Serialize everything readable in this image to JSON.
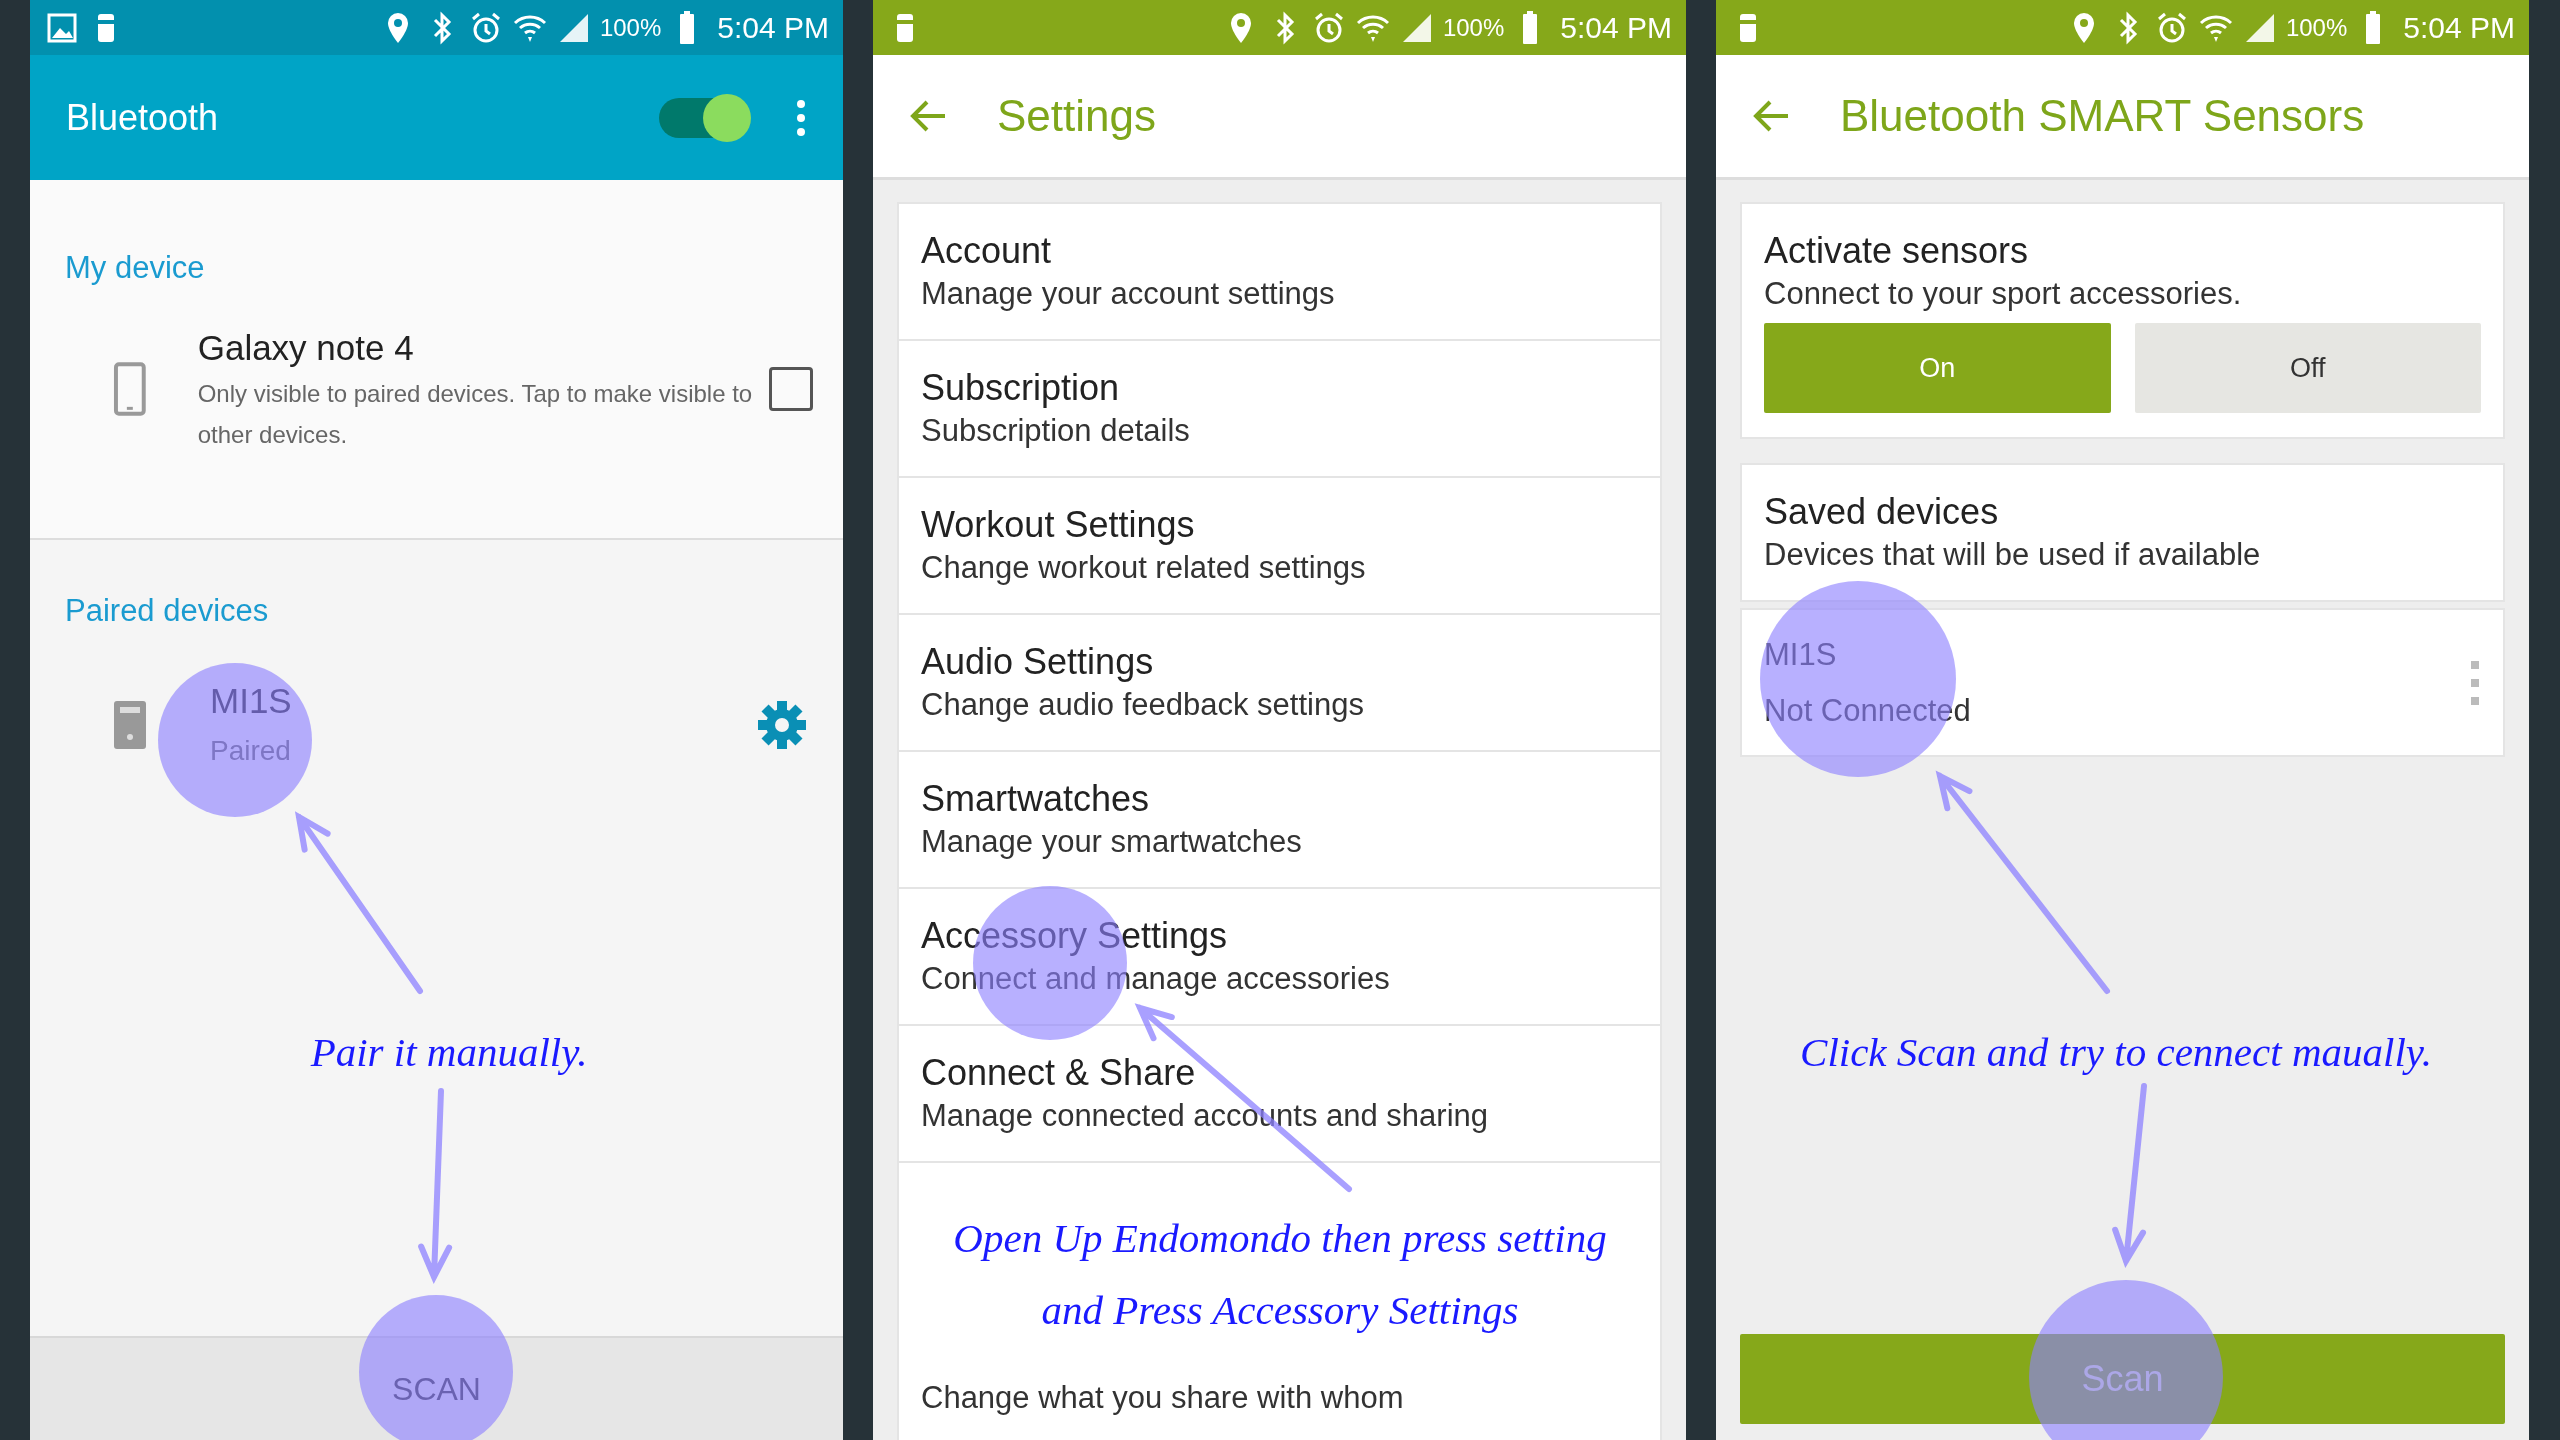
{
  "bluetooth_screen": {
    "status_bar": {
      "battery": "100%",
      "time": "5:04 PM"
    },
    "title": "Bluetooth",
    "toggle_on": true,
    "my_device": {
      "header": "My device",
      "name": "Galaxy note 4",
      "description": "Only visible to paired devices. Tap to make visible to other devices.",
      "checked": false
    },
    "paired_devices": {
      "header": "Paired devices",
      "items": [
        {
          "name": "MI1S",
          "status": "Paired"
        }
      ]
    },
    "scan_button": "SCAN"
  },
  "settings_screen": {
    "status_bar": {
      "battery": "100%",
      "time": "5:04 PM"
    },
    "title": "Settings",
    "items": [
      {
        "title": "Account",
        "subtitle": "Manage your account settings"
      },
      {
        "title": "Subscription",
        "subtitle": "Subscription details"
      },
      {
        "title": "Workout Settings",
        "subtitle": "Change workout related settings"
      },
      {
        "title": "Audio Settings",
        "subtitle": "Change audio feedback settings"
      },
      {
        "title": "Smartwatches",
        "subtitle": "Manage your smartwatches"
      },
      {
        "title": "Accessory Settings",
        "subtitle": "Connect and manage accessories"
      },
      {
        "title": "Connect & Share",
        "subtitle": "Manage connected accounts and sharing"
      },
      {
        "subtitle": "Change what you share with whom"
      }
    ]
  },
  "sensors_screen": {
    "status_bar": {
      "battery": "100%",
      "time": "5:04 PM"
    },
    "title": "Bluetooth SMART Sensors",
    "activate": {
      "title": "Activate sensors",
      "subtitle": "Connect to your sport accessories.",
      "buttons": [
        {
          "label": "On",
          "selected": true
        },
        {
          "label": "Off",
          "selected": false
        }
      ]
    },
    "saved": {
      "title": "Saved devices",
      "subtitle": "Devices that will be used if available",
      "devices": [
        {
          "name": "MI1S",
          "status": "Not Connected"
        }
      ]
    },
    "scan_button": "Scan"
  },
  "annotations": [
    "Pair it manually.",
    "Open Up Endomondo then press setting",
    "and  Press Accessory Settings",
    "Click Scan and try to cennect maually."
  ]
}
